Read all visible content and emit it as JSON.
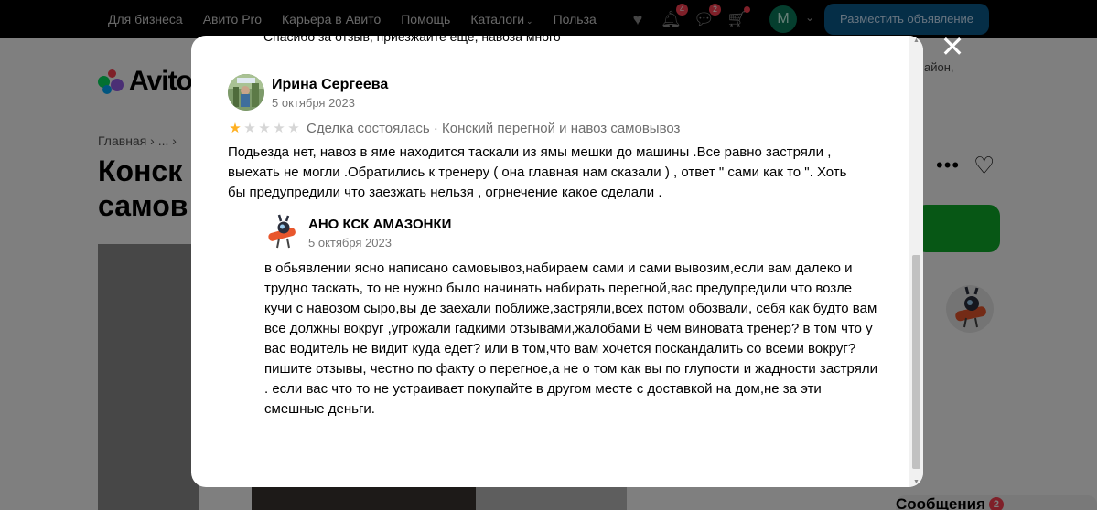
{
  "topnav": {
    "items": [
      "Для бизнеса",
      "Авито Pro",
      "Карьера в Авито",
      "Помощь",
      "Каталоги",
      "Польза"
    ],
    "notifications_count": "4",
    "messages_count": "2",
    "avatar_letter": "M",
    "post_button": "Разместить объявление"
  },
  "page": {
    "logo": "Avito",
    "breadcrumb": "Главная › ... ›",
    "title_partial": "Конск самов",
    "region_partial": "айон,",
    "messages_label": "Сообщения",
    "messages_badge": "2"
  },
  "modal": {
    "prev_reply_partial": "Спасибо за отзыв, приезжайте еще, навоза много",
    "review": {
      "author": "Ирина Сергеева",
      "date": "5 октября 2023",
      "rating": 1,
      "rating_max": 5,
      "meta": "Сделка состоялась · Конский перегной и навоз самовывоз",
      "text": "Подьезда нет, навоз в яме находится таскали из ямы мешки до машины .Все равно застряли , выехать не могли .Обратились к тренеру ( она главная нам сказали ) , ответ \" сами как то \". Хоть бы предупредили что заезжать нельзя , огрнечение какое сделали ."
    },
    "reply": {
      "author": "АНО КСК АМАЗОНКИ",
      "date": "5 октября 2023",
      "text": "в обьявлении ясно написано самовывоз,набираем сами и сами вывозим,если вам далеко и трудно таскать, то не нужно было начинать набирать перегной,вас предупредили что возле кучи с навозом сыро,вы де заехали поближе,застряли,всех потом обозвали, себя как будто вам все должны вокруг ,угрожали гадкими отзывами,жалобами В чем виновата тренер? в том что у вас водитель не видит куда едет? или в том,что вам хочется поскандалить со всеми вокруг? пишите отзывы, честно по факту о перегное,а не о том как вы по глупости и жадности застряли . если вас что то не устраивает покупайте в другом месте с доставкой на дом,не за эти смешные деньги."
    }
  }
}
